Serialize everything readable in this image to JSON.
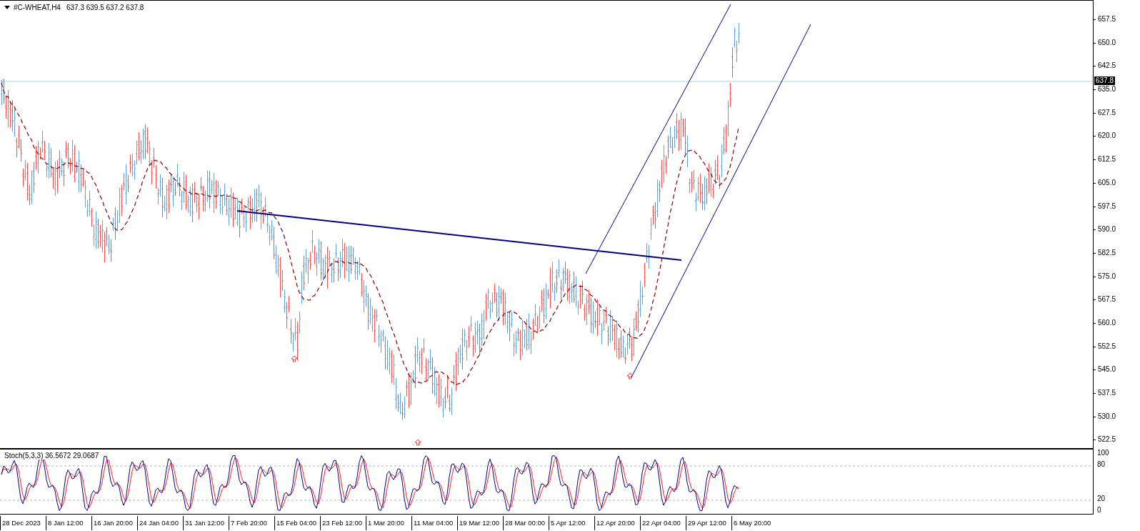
{
  "chart": {
    "symbol": "#C-WHEAT,H4",
    "ohlc": "637.3 639.5 637.2 637.8",
    "current_price": "637.8",
    "price_labels": [
      "657.5",
      "650.0",
      "642.5",
      "635.0",
      "627.5",
      "620.0",
      "612.5",
      "605.0",
      "597.5",
      "590.0",
      "582.5",
      "575.0",
      "567.5",
      "560.0",
      "552.5",
      "545.0",
      "537.5",
      "530.0",
      "522.5"
    ]
  },
  "oscillator": {
    "label": "Stoch(5,3,3) 36.5672 29.0687",
    "levels": [
      {
        "label": "100"
      },
      {
        "label": "80"
      },
      {
        "label": "20"
      },
      {
        "label": "0"
      }
    ]
  },
  "time_axis": [
    "28 Dec 2023",
    "8 Jan 12:00",
    "16 Jan 20:00",
    "24 Jan 04:00",
    "31 Jan 12:00",
    "7 Feb 20:00",
    "15 Feb 04:00",
    "23 Feb 12:00",
    "1 Mar 20:00",
    "11 Mar 04:00",
    "19 Mar 12:00",
    "28 Mar 00:00",
    "5 Apr 12:00",
    "12 Apr 20:00",
    "22 Apr 04:00",
    "29 Apr 12:00",
    "6 May 20:00"
  ]
}
